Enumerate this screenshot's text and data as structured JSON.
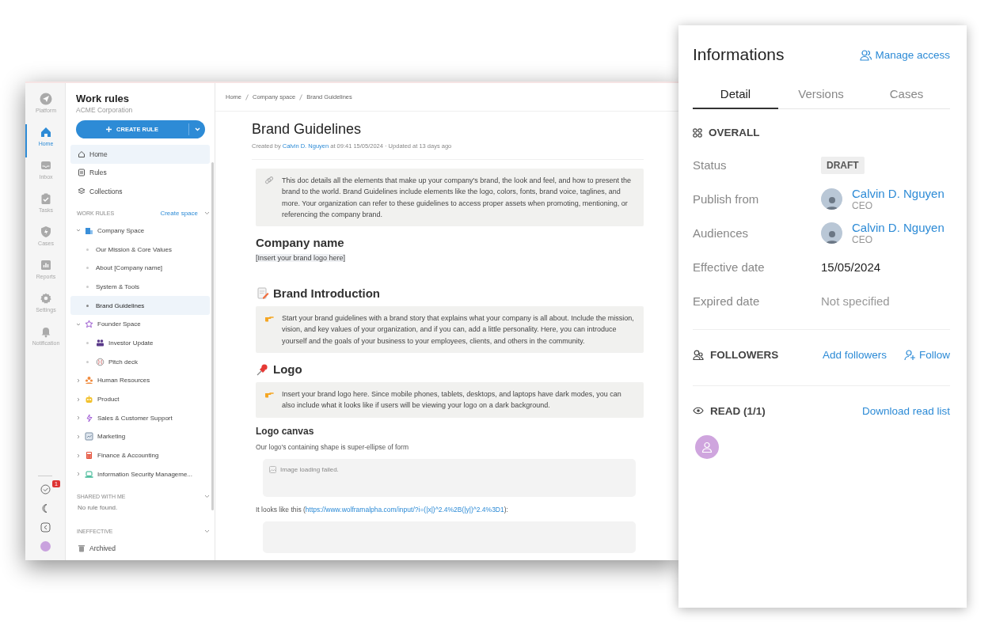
{
  "rail": {
    "items": [
      {
        "label": "Platform",
        "selected": false
      },
      {
        "label": "Home",
        "selected": true
      },
      {
        "label": "Inbox",
        "selected": false
      },
      {
        "label": "Tasks",
        "selected": false
      },
      {
        "label": "Cases",
        "selected": false
      },
      {
        "label": "Reports",
        "selected": false
      },
      {
        "label": "Settings",
        "selected": false
      },
      {
        "label": "Notification",
        "selected": false
      }
    ],
    "task_badge": "1"
  },
  "sidebar": {
    "title": "Work rules",
    "subtitle": "ACME Corporation",
    "create_button": "CREATE RULE",
    "nav": [
      {
        "label": "Home",
        "selected": true
      },
      {
        "label": "Rules",
        "selected": false
      },
      {
        "label": "Collections",
        "selected": false
      }
    ],
    "work_rules": {
      "heading": "WORK RULES",
      "action": "Create space",
      "tree": [
        {
          "label": "Company Space",
          "selected": false,
          "expanded": true,
          "children": [
            {
              "label": "Our Mission & Core Values",
              "selected": false
            },
            {
              "label": "About [Company name]",
              "selected": false
            },
            {
              "label": "System & Tools",
              "selected": false
            },
            {
              "label": "Brand Guidelines",
              "selected": true
            }
          ]
        },
        {
          "label": "Founder Space",
          "selected": false,
          "expanded": true,
          "children": [
            {
              "label": "Investor Update",
              "selected": false
            },
            {
              "label": "Pitch deck",
              "selected": false
            }
          ]
        },
        {
          "label": "Human Resources",
          "selected": false,
          "expanded": false
        },
        {
          "label": "Product",
          "selected": false,
          "expanded": false
        },
        {
          "label": "Sales & Customer Support",
          "selected": false,
          "expanded": false
        },
        {
          "label": "Marketing",
          "selected": false,
          "expanded": false
        },
        {
          "label": "Finance & Accounting",
          "selected": false,
          "expanded": false
        },
        {
          "label": "Information Security Manageme...",
          "selected": false,
          "expanded": false
        }
      ]
    },
    "shared": {
      "heading": "SHARED WITH ME",
      "empty": "No rule found."
    },
    "ineffective": {
      "heading": "INEFFECTIVE",
      "items": [
        "Archived"
      ]
    }
  },
  "breadcrumb": [
    "Home",
    "Company space",
    "Brand Guidelines"
  ],
  "document": {
    "title": "Brand Guidelines",
    "meta": {
      "prefix": "Created by",
      "author": "Calvin D. Nguyen",
      "suffix": "at 09:41 15/05/2024 · Updated at 13 days ago"
    },
    "blocks": [
      {
        "kind": "callout",
        "text": "This doc details all the elements that make up your company's brand, the look and feel, and how to present the brand to the world. Brand Guidelines include elements like the logo, colors, fonts, brand voice, taglines, and more. Your organization can refer to these guidelines to access proper assets when promoting, mentioning, or referencing the company brand."
      },
      {
        "kind": "heading",
        "text": "Company name"
      },
      {
        "kind": "highlight",
        "text": "[Insert your brand logo here]"
      },
      {
        "kind": "section",
        "text": "Brand Introduction"
      },
      {
        "kind": "callout",
        "text": "Start your brand guidelines with a brand story that explains what your company is all about. Include the mission, vision, and key values of your organization, and if you can, add a little personality. Here, you can introduce yourself and the goals of your business to your employees, clients, and others in the community."
      },
      {
        "kind": "section",
        "text": "Logo"
      },
      {
        "kind": "callout",
        "text": "Insert your brand logo here. Since mobile phones, tablets, desktops, and laptops have dark modes, you can also include what it looks like if users will be viewing your logo on a dark background."
      },
      {
        "kind": "subheading",
        "text": "Logo canvas"
      },
      {
        "kind": "paragraph",
        "text": "Our logo's containing shape is super-ellipse of form"
      },
      {
        "kind": "broken-image",
        "text": "Image loading failed."
      },
      {
        "kind": "link-paragraph",
        "before": "It looks like this (",
        "link": "https://www.wolframalpha.com/input/?i=(|x|)^2.4%2B(|y|)^2.4%3D1",
        "after": "):"
      },
      {
        "kind": "frame"
      }
    ]
  },
  "panel": {
    "title": "Informations",
    "manage": "Manage access",
    "tabs": [
      {
        "label": "Detail",
        "selected": true
      },
      {
        "label": "Versions",
        "selected": false
      },
      {
        "label": "Cases",
        "selected": false
      }
    ],
    "overall": "OVERALL",
    "fields": [
      {
        "kind": "tag",
        "label": "Status",
        "value": "DRAFT"
      },
      {
        "kind": "person",
        "label": "Publish from",
        "name": "Calvin D. Nguyen",
        "role": "CEO"
      },
      {
        "kind": "person",
        "label": "Audiences",
        "name": "Calvin D. Nguyen",
        "role": "CEO"
      },
      {
        "kind": "text",
        "label": "Effective date",
        "value": "15/05/2024"
      },
      {
        "kind": "muted",
        "label": "Expired date",
        "value": "Not specified"
      }
    ],
    "followers": {
      "heading": "FOLLOWERS",
      "add": "Add followers",
      "follow": "Follow"
    },
    "read": {
      "heading": "READ (1/1)",
      "download": "Download read list"
    }
  }
}
